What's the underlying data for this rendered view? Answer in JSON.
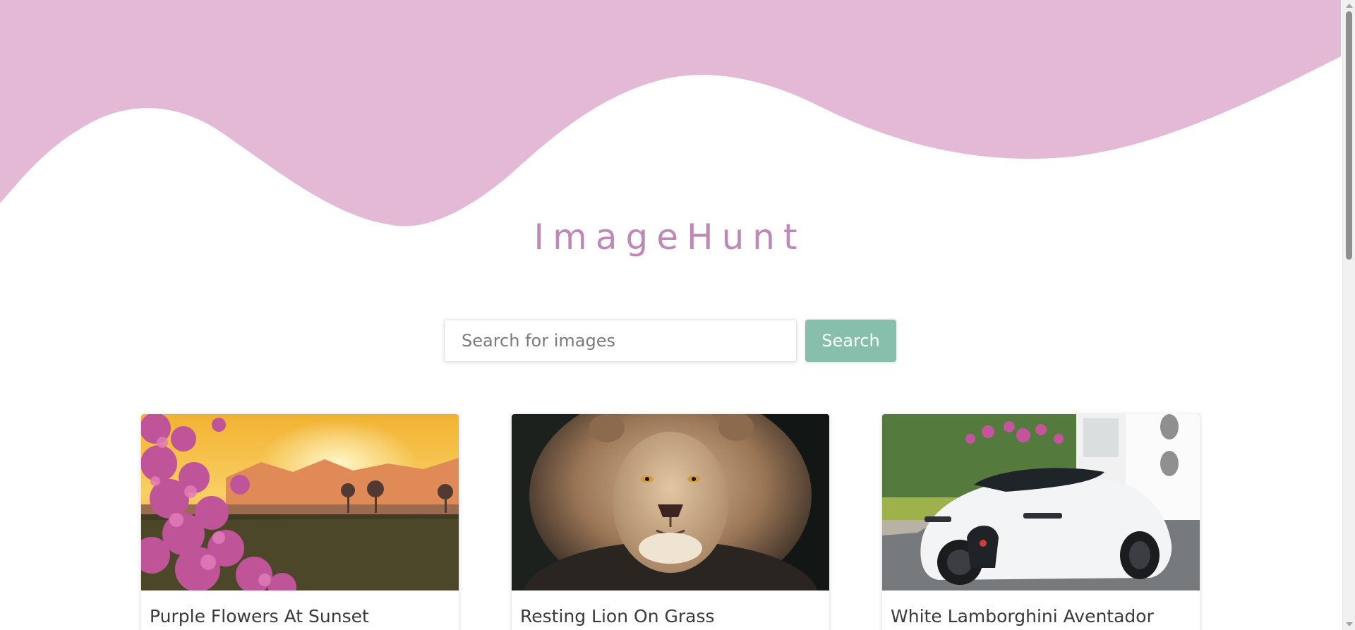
{
  "app": {
    "title": "ImageHunt"
  },
  "colors": {
    "wave": "#e4b9d5",
    "brand": "#c088b6",
    "search_button": "#86bfab"
  },
  "search": {
    "placeholder": "Search for images",
    "value": "",
    "button_label": "Search"
  },
  "results": [
    {
      "title": "Purple Flowers At Sunset",
      "image": "purple-flowers-sunset"
    },
    {
      "title": "Resting Lion On Grass",
      "image": "lion-portrait"
    },
    {
      "title": "White Lamborghini Aventador",
      "image": "white-sports-car"
    }
  ]
}
